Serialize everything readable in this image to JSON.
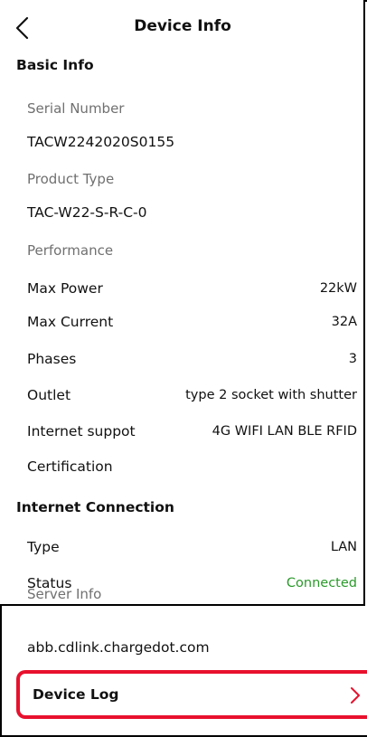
{
  "header": {
    "title": "Device Info",
    "back_icon": "chevron-left-icon"
  },
  "basic_info": {
    "section_title": "Basic Info",
    "serial_label": "Serial Number",
    "serial_value": "TACW2242020S0155",
    "product_type_label": "Product Type",
    "product_type_value": "TAC-W22-S-R-C-0",
    "performance_label": "Performance",
    "rows": [
      {
        "label": "Max Power",
        "value": "22kW"
      },
      {
        "label": "Max Current",
        "value": "32A"
      },
      {
        "label": "Phases",
        "value": "3"
      },
      {
        "label": "Outlet",
        "value": "type 2 socket with shutter"
      },
      {
        "label": "Internet suppot",
        "value": "4G WIFI LAN BLE RFID"
      },
      {
        "label": "Certification",
        "value": ""
      }
    ]
  },
  "internet_connection": {
    "section_title": "Internet Connection",
    "type_label": "Type",
    "type_value": "LAN",
    "status_label": "Status",
    "status_value": "Connected",
    "server_info_label": "Server Info",
    "server_value": "abb.cdlink.chargedot.com"
  },
  "device_log": {
    "label": "Device Log",
    "chevron_icon": "chevron-right-icon"
  },
  "colors": {
    "highlight": "#e8112d",
    "status_connected": "#2a9a2a",
    "muted_text": "#707070"
  }
}
